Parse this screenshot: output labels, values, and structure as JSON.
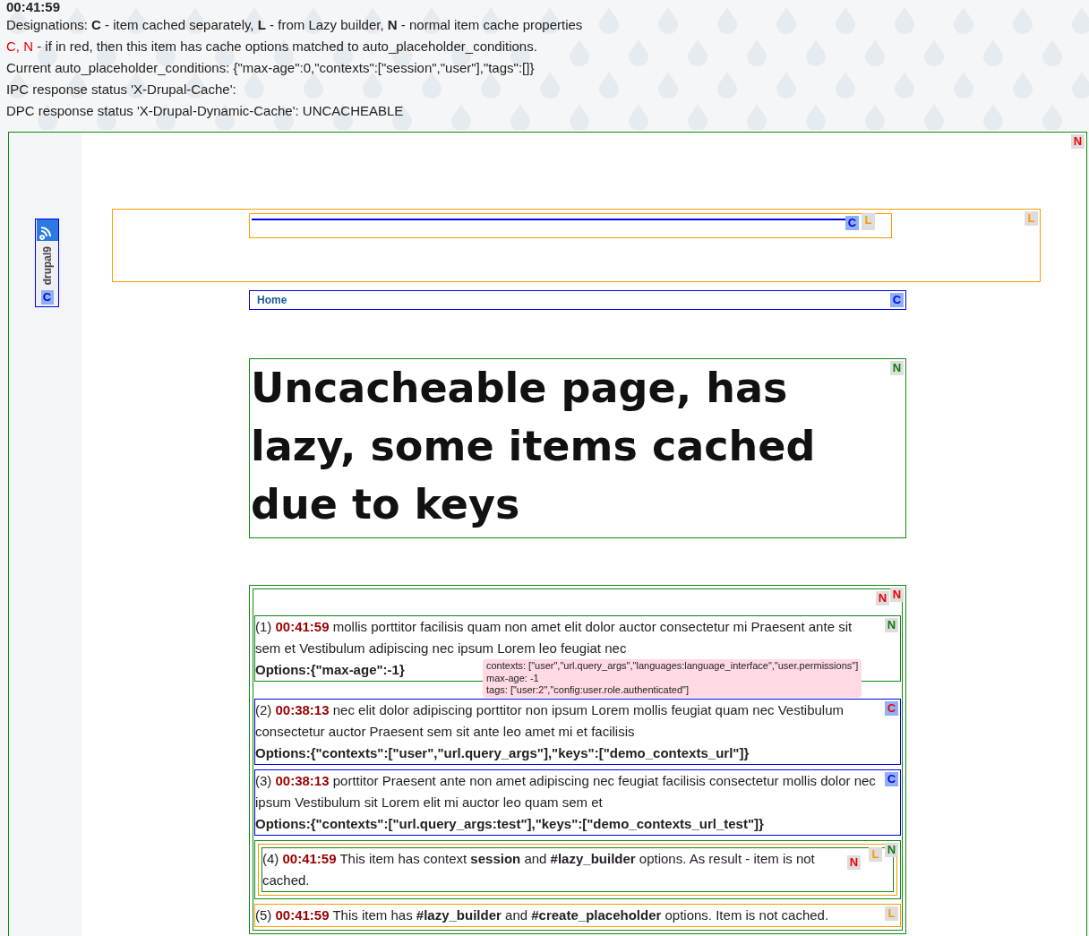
{
  "timestamp": "00:41:59",
  "legend": [
    {
      "text": "Designations: **C** - item cached separately, **L** - from Lazy builder, **N** - normal item cache properties"
    },
    {
      "highlight": "C, N",
      "text": " - if in red, then this item has cache options matched to auto_placeholder_conditions."
    },
    {
      "text": "Current auto_placeholder_conditions: {\"max-age\":0,\"contexts\":[\"session\",\"user\"],\"tags\":[]}"
    },
    {
      "text": "IPC response status 'X-Drupal-Cache':"
    },
    {
      "text": "DPC response status 'X-Drupal-Dynamic-Cache': UNCACHEABLE"
    }
  ],
  "page": {
    "kind": "normal",
    "badges": [
      {
        "letter": "N",
        "kind": "normal",
        "matched": true
      }
    ]
  },
  "toolbar_tab": {
    "label": "drupal9",
    "badges": [
      {
        "letter": "C",
        "kind": "cached",
        "matched": false
      }
    ]
  },
  "header_region": {
    "kind": "lazy",
    "badges": [
      {
        "letter": "L",
        "kind": "lazy",
        "matched": false
      }
    ],
    "inner": {
      "kind": "lazy",
      "badges": [
        {
          "letter": "C",
          "kind": "cached",
          "matched": false
        },
        {
          "letter": "L",
          "kind": "lazy",
          "matched": false
        }
      ]
    }
  },
  "nav": {
    "kind": "cached",
    "badges": [
      {
        "letter": "C",
        "kind": "cached",
        "matched": false
      }
    ],
    "links": [
      {
        "label": "Home"
      }
    ]
  },
  "title_block": {
    "kind": "normal",
    "badges": [
      {
        "letter": "N",
        "kind": "normal",
        "matched": false
      }
    ],
    "title": "Uncacheable page, has lazy, some items cached due to keys"
  },
  "content": {
    "frames": [
      {
        "kind": "normal",
        "badges": [
          {
            "letter": "N",
            "kind": "normal",
            "matched": true
          }
        ]
      },
      {
        "kind": "normal",
        "badges": [
          {
            "letter": "N",
            "kind": "normal",
            "matched": true
          }
        ]
      }
    ]
  },
  "items": [
    {
      "number": "(1)",
      "time": "00:41:59",
      "text": "mollis porttitor facilisis quam non amet elit dolor auctor consectetur mi Praesent ante sit sem et Vestibulum adipiscing nec ipsum Lorem leo feugiat nec",
      "options": "Options:{\"max-age\":-1}",
      "frames": [
        {
          "kind": "normal",
          "badges": [
            {
              "letter": "N",
              "kind": "normal",
              "matched": false
            }
          ]
        }
      ]
    },
    {
      "number": "(2)",
      "time": "00:38:13",
      "text": "nec elit dolor adipiscing porttitor non ipsum Lorem mollis feugiat quam nec Vestibulum consectetur auctor Praesent sem sit ante leo amet mi et facilisis",
      "options": "Options:{\"contexts\":[\"user\",\"url.query_args\"],\"keys\":[\"demo_contexts_url\"]}",
      "frames": [
        {
          "kind": "cached",
          "badges": [
            {
              "letter": "C",
              "kind": "cached",
              "matched": true
            }
          ]
        }
      ]
    },
    {
      "number": "(3)",
      "time": "00:38:13",
      "text": "porttitor Praesent ante non amet adipiscing nec feugiat facilisis consectetur mollis dolor nec ipsum Vestibulum sit Lorem elit mi auctor leo quam sem et",
      "options": "Options:{\"contexts\":[\"url.query_args:test\"],\"keys\":[\"demo_contexts_url_test\"]}",
      "frames": [
        {
          "kind": "cached",
          "badges": [
            {
              "letter": "C",
              "kind": "cached",
              "matched": false
            }
          ]
        }
      ]
    },
    {
      "number": "(4)",
      "time": "00:41:59",
      "text": "This item has context **session** and **#lazy_builder** options. As result - item is not cached.",
      "frames": [
        {
          "kind": "normal",
          "badges": [
            {
              "letter": "N",
              "kind": "normal",
              "matched": false
            }
          ]
        },
        {
          "kind": "lazy",
          "badges": [
            {
              "letter": "L",
              "kind": "lazy",
              "matched": false
            }
          ]
        },
        {
          "kind": "normal",
          "badges": [
            {
              "letter": "N",
              "kind": "normal",
              "matched": true
            }
          ]
        }
      ]
    },
    {
      "number": "(5)",
      "time": "00:41:59",
      "text": "This item has **#lazy_builder** and **#create_placeholder** options. Item is not cached.",
      "frames": [
        {
          "kind": "lazy",
          "badges": [
            {
              "letter": "L",
              "kind": "lazy",
              "matched": false
            }
          ]
        }
      ]
    }
  ],
  "tooltip": {
    "lines": [
      "contexts: [\"user\",\"url.query_args\",\"languages:language_interface\",\"user.permissions\"]",
      "max-age: -1",
      "tags: [\"user:2\",\"config:user.role.authenticated\"]"
    ]
  }
}
